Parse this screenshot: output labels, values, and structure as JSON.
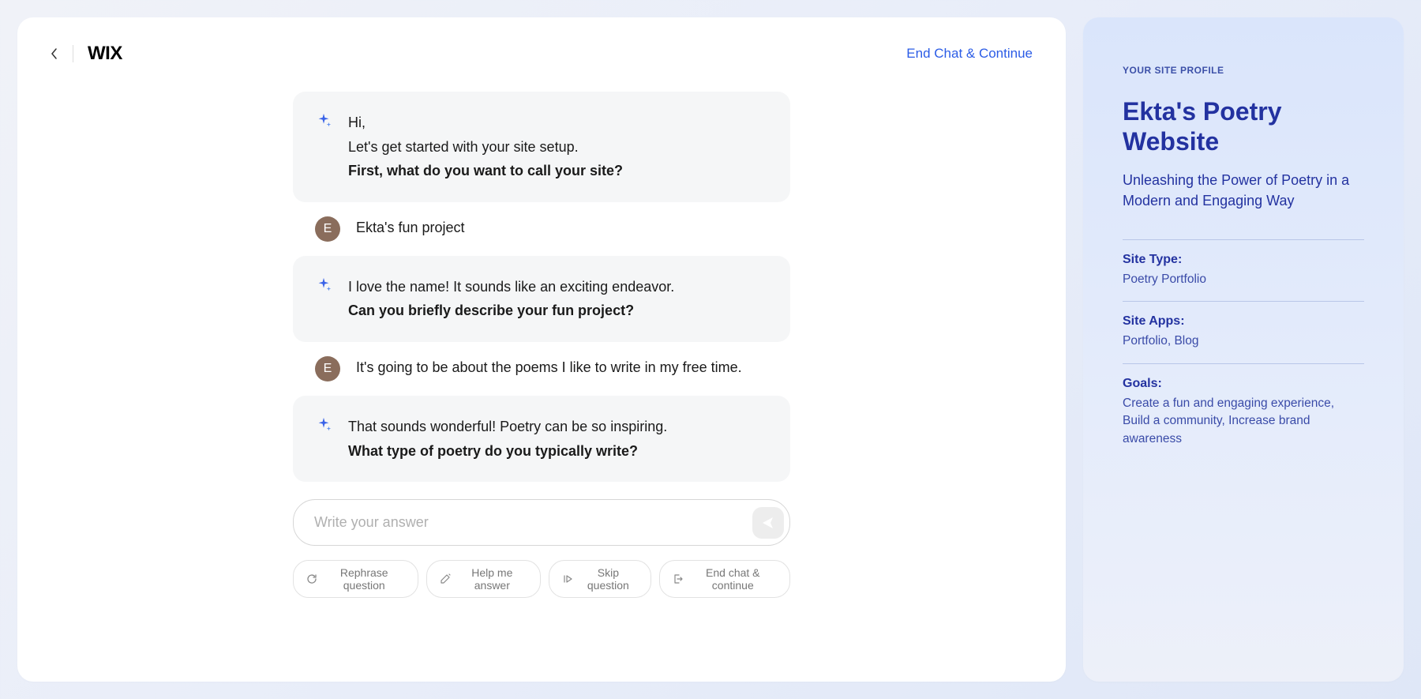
{
  "header": {
    "logo": "WIX",
    "end_chat_link": "End Chat & Continue"
  },
  "chat": {
    "user_initial": "E",
    "messages": [
      {
        "type": "ai",
        "lines": [
          "Hi,",
          "Let's get started with your site setup."
        ],
        "question": "First, what do you want to call your site?"
      },
      {
        "type": "user",
        "text": "Ekta's fun project"
      },
      {
        "type": "ai",
        "lines": [
          "I love the name! It sounds like an exciting endeavor."
        ],
        "question": "Can you briefly describe your fun project?"
      },
      {
        "type": "user",
        "text": "It's going to be about the poems I like to write in my free time."
      },
      {
        "type": "ai",
        "lines": [
          "That sounds wonderful! Poetry can be so inspiring."
        ],
        "question": "What type of poetry do you typically write?"
      }
    ]
  },
  "input": {
    "placeholder": "Write your answer"
  },
  "actions": {
    "rephrase": "Rephrase question",
    "help": "Help me answer",
    "skip": "Skip question",
    "end": "End chat & continue"
  },
  "profile": {
    "kicker": "YOUR SITE PROFILE",
    "title": "Ekta's Poetry Website",
    "subtitle": "Unleashing the Power of Poetry in a Modern and Engaging Way",
    "fields": [
      {
        "label": "Site Type:",
        "value": "Poetry Portfolio"
      },
      {
        "label": "Site Apps:",
        "value": "Portfolio, Blog"
      },
      {
        "label": "Goals:",
        "value": "Create a fun and engaging experience, Build a community, Increase brand awareness"
      }
    ]
  }
}
